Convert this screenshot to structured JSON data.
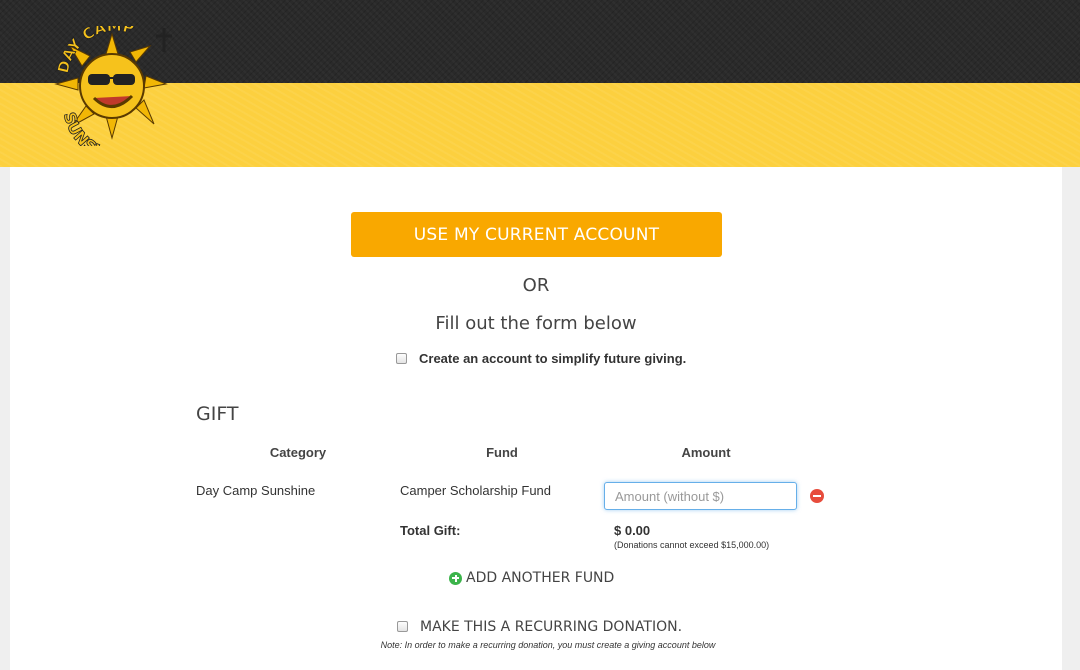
{
  "header": {
    "logo_text_top": "DAY CAMP",
    "logo_text_bottom": "SUNSHINE",
    "colors": {
      "dark": "#2a2a2a",
      "yellow": "#fcd03f"
    }
  },
  "account": {
    "use_current_label": "USE MY CURRENT ACCOUNT",
    "or_label": "OR",
    "fill_label": "Fill out the form below",
    "create_account_label": "Create an account to simplify future giving.",
    "button_color": "#f9a800"
  },
  "gift": {
    "title": "GIFT",
    "columns": [
      "Category",
      "Fund",
      "Amount"
    ],
    "rows": [
      {
        "category": "Day Camp Sunshine",
        "fund": "Camper Scholarship Fund",
        "amount_placeholder": "Amount (without $)",
        "amount_value": ""
      }
    ],
    "total_label": "Total Gift:",
    "total_amount": "$ 0.00",
    "total_note": "(Donations cannot exceed $15,000.00)",
    "add_fund_label": "ADD ANOTHER FUND",
    "remove_icon": "remove-circle-icon",
    "add_icon": "plus-circle-icon"
  },
  "recurring": {
    "label": "MAKE THIS A RECURRING DONATION.",
    "note": "Note: In order to make a recurring donation, you must create a giving account below"
  }
}
